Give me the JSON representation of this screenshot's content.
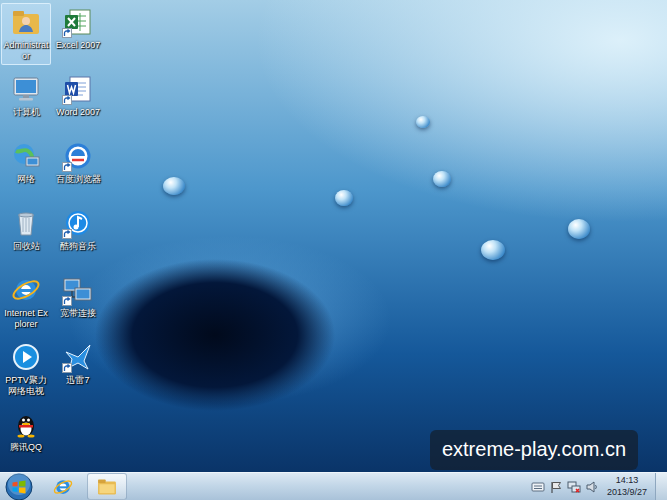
{
  "desktop": {
    "icons": [
      {
        "label": "Administrator",
        "selected": true,
        "shortcut": false
      },
      {
        "label": "计算机",
        "selected": false,
        "shortcut": false
      },
      {
        "label": "网络",
        "selected": false,
        "shortcut": false
      },
      {
        "label": "回收站",
        "selected": false,
        "shortcut": false
      },
      {
        "label": "Internet Explorer",
        "selected": false,
        "shortcut": false
      },
      {
        "label": "PPTV聚力 网络电视",
        "selected": false,
        "shortcut": false
      },
      {
        "label": "腾讯QQ",
        "selected": false,
        "shortcut": false
      },
      {
        "label": "Excel 2007",
        "selected": false,
        "shortcut": true
      },
      {
        "label": "Word 2007",
        "selected": false,
        "shortcut": true
      },
      {
        "label": "百度浏览器",
        "selected": false,
        "shortcut": true
      },
      {
        "label": "酷狗音乐",
        "selected": false,
        "shortcut": true
      },
      {
        "label": "宽带连接",
        "selected": false,
        "shortcut": true
      },
      {
        "label": "迅雷7",
        "selected": false,
        "shortcut": true
      }
    ]
  },
  "taskbar": {
    "clock": {
      "time": "14:13",
      "date": "2013/9/27"
    }
  },
  "watermark": {
    "text": "extreme-play.com.cn"
  }
}
